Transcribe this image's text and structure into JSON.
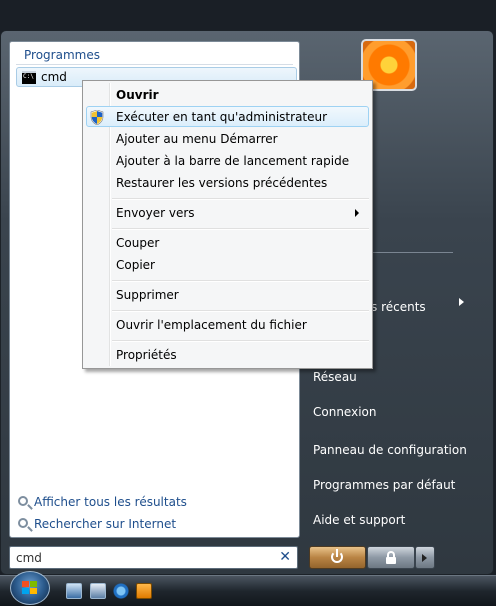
{
  "start_menu": {
    "programs_header": "Programmes",
    "programs": [
      {
        "label": "cmd",
        "icon": "cmd-icon"
      }
    ],
    "bottom_links": [
      {
        "label": "Afficher tous les résultats",
        "icon": "search-icon"
      },
      {
        "label": "Rechercher sur Internet",
        "icon": "search-icon"
      }
    ],
    "search": {
      "value": "cmd",
      "clear_icon": "✕"
    },
    "right_pane": {
      "recent_partial": "s récents",
      "items": [
        "Réseau",
        "Connexion",
        "Panneau de configuration",
        "Programmes par défaut",
        "Aide et support"
      ]
    }
  },
  "context_menu": {
    "items": {
      "open": "Ouvrir",
      "run_admin": "Exécuter en tant qu'administrateur",
      "pin_start": "Ajouter au menu Démarrer",
      "pin_quicklaunch": "Ajouter à la barre de lancement rapide",
      "restore": "Restaurer les versions précédentes",
      "send_to": "Envoyer vers",
      "cut": "Couper",
      "copy": "Copier",
      "delete": "Supprimer",
      "open_location": "Ouvrir l'emplacement du fichier",
      "properties": "Propriétés"
    }
  },
  "taskbar": {
    "quick_launch": [
      "show-desktop-icon",
      "switch-windows-icon",
      "internet-explorer-icon",
      "media-player-icon"
    ]
  },
  "colors": {
    "link_blue": "#1e4e8c",
    "menu_highlight": "#dbeefb",
    "power_button": "#b98444"
  }
}
